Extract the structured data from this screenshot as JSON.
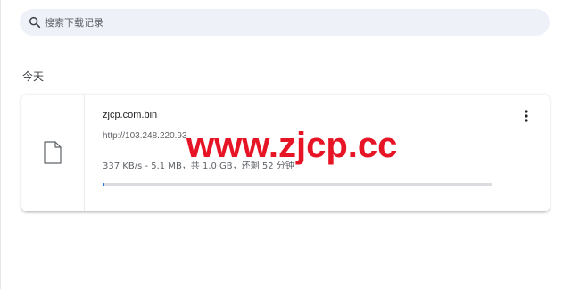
{
  "search": {
    "placeholder": "搜索下载记录",
    "icon": "search-icon"
  },
  "section": {
    "title": "今天"
  },
  "download": {
    "file_icon": "file-icon",
    "file_name": "zjcp.com.bin",
    "url": "http://103.248.220.93",
    "progress_text": "337 KB/s - 5.1 MB，共 1.0 GB，还剩 52 分钟",
    "progress_fraction": 0.005,
    "more_icon": "more-vert-icon"
  },
  "watermark": {
    "text": "www.zjcp.cc"
  },
  "colors": {
    "search_bg": "#eef1f8",
    "progress_track": "#dadce0",
    "progress_fill": "#1a73e8",
    "watermark": "#e50014"
  }
}
